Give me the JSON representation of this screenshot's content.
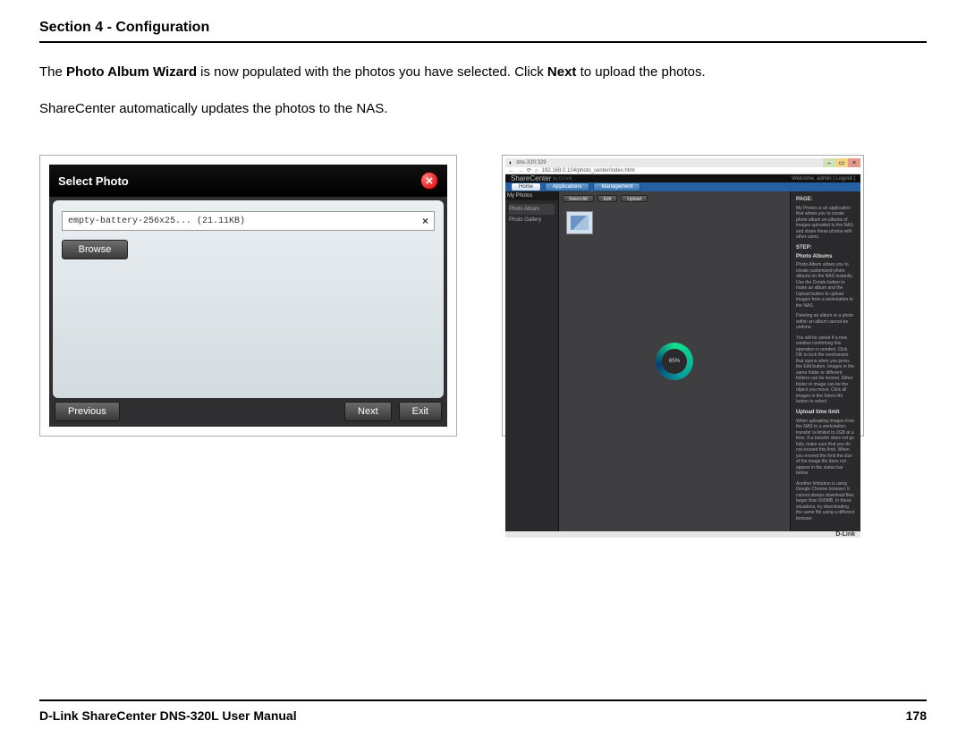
{
  "header": {
    "section_title": "Section 4 - Configuration"
  },
  "body": {
    "p1_a": "The ",
    "p1_b": "Photo Album Wizard",
    "p1_c": " is now populated with the photos you have selected. Click ",
    "p1_d": "Next",
    "p1_e": " to upload the photos.",
    "p2": "ShareCenter automatically updates the photos to the NAS."
  },
  "dialog": {
    "title": "Select Photo",
    "file_name": "empty-battery-256x25... (21.11KB)",
    "remove_glyph": "×",
    "browse_label": "Browse",
    "previous_label": "Previous",
    "next_label": "Next",
    "exit_label": "Exit",
    "close_glyph": "✕"
  },
  "browser": {
    "tab_title": "dns-320:329",
    "url": "192.168.0.104/photo_center/index.html",
    "brand": "ShareCenter",
    "brand_sub": "by D-Link",
    "welcome": "Welcome, admin | Logout | ",
    "nav": {
      "home": "Home",
      "apps": "Applications",
      "mgmt": "Management"
    },
    "side": {
      "header": "My Photos",
      "item1": "Photo Album",
      "item2": "Photo Gallery"
    },
    "tools": {
      "t1": "Select All",
      "t2": "Edit",
      "t3": "Upload"
    },
    "progress": "65%",
    "help": {
      "h1": "PAGE:",
      "p1": "My Photos is an application that allows you to create photo album on albums of images uploaded to the NAS and share these photos with other users.",
      "h2": "STEP:",
      "h2b": "Photo Albums",
      "p2": "Photo Album allows you to create customized photo albums on the NAS instantly. Use the Create button to make an album and the Upload button to upload images from a workstation to the NAS.",
      "p3": "Deleting an album or a photo within an album cannot be undone.",
      "p4": "You will be asked if a new window confirming this operation is needed. Click OK to lock the mechanism that opens when you press the Edit button. Images in the same folder or different folders can be moved. Either folder or image can be the object you move. Click all images in the Select All button to select.",
      "h3": "Upload time limit",
      "p5": "When uploading images from the NAS to a workstation, transfer is limited to 2GB at a time. If a transfer does not go fully, make sure that you do not exceed this limit. When you exceed the limit the size of the image file does not appear in the status bar below.",
      "p6": "Another limitation is using Google Chrome browser; it cannot always download files larger than 500MB. In these situations, try downloading the same file using a different browser."
    },
    "footer_brand": "D-Link"
  },
  "footer": {
    "manual": "D-Link ShareCenter DNS-320L User Manual",
    "page": "178"
  }
}
